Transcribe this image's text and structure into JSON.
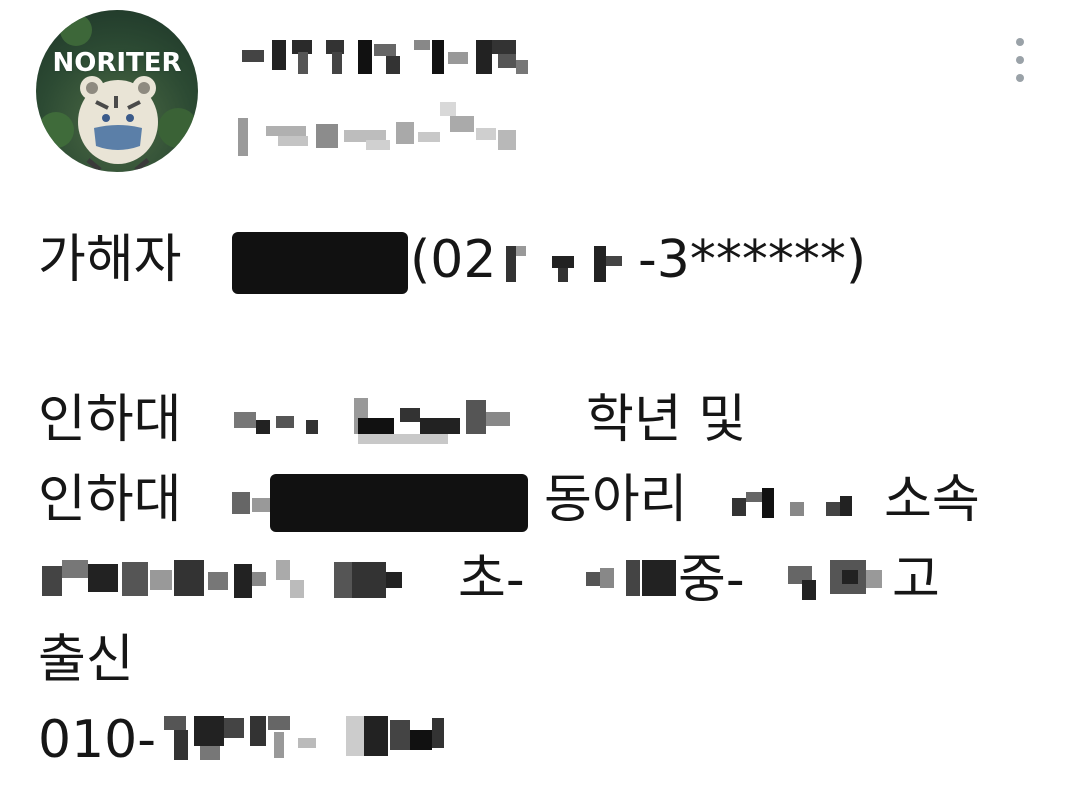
{
  "avatar": {
    "brand_text": "NORITER",
    "icon": "tiger-icon"
  },
  "menu": {
    "icon": "more-vert-icon"
  },
  "tweet": {
    "line1": {
      "prefix": "가해자",
      "phone_open": "(02",
      "suffix": "-3******)"
    },
    "line2": {
      "prefix": "인하대",
      "suffix": "학년 및"
    },
    "line3": {
      "prefix": "인하대",
      "mid": "동아리",
      "suffix": "소속"
    },
    "line4": {
      "a": "초-",
      "b": "중-",
      "c": "고"
    },
    "line5": {
      "text": "출신"
    },
    "line6": {
      "prefix": "010-"
    }
  }
}
